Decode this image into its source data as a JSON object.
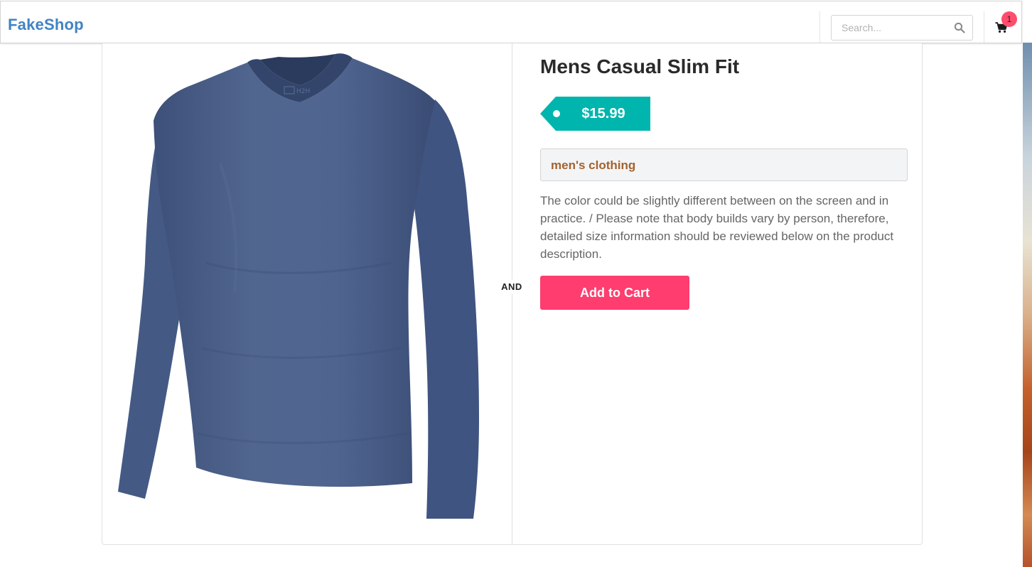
{
  "navbar": {
    "brand": "FakeShop",
    "search": {
      "placeholder": "Search...",
      "value": "",
      "icon": "search-icon"
    },
    "cart": {
      "icon": "shopping-cart-icon",
      "badge_count": "1"
    }
  },
  "product": {
    "title": "Mens Casual Slim Fit",
    "price": "$15.99",
    "category": "men's clothing",
    "description": "The color could be slightly different between on the screen and in practice. / Please note that body builds vary by person, therefore, detailed size information should be reviewed below on the product description.",
    "image": "long-sleeve-v-neck-tshirt",
    "add_to_cart_label": "Add to Cart"
  },
  "divider": {
    "label": "AND"
  },
  "colors": {
    "brand": "#4183c4",
    "price_tag": "#00b5ad",
    "category_text": "#a3622e",
    "add_to_cart": "#ff3d6e",
    "badge": "#ff4d6d",
    "shirt": "#4a5f88"
  }
}
